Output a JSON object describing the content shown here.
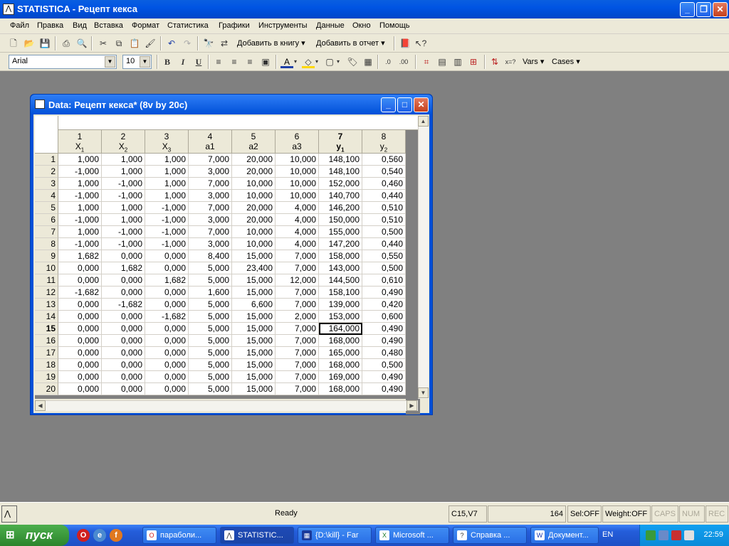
{
  "window": {
    "app_title": "STATISTICA - Рецепт кекса",
    "min_label": "_",
    "max_label": "❐",
    "close_label": "✕"
  },
  "menu": {
    "items": [
      "Файл",
      "Правка",
      "Вид",
      "Вставка",
      "Формат",
      "Статистика",
      "Графики",
      "Инструменты",
      "Данные",
      "Окно",
      "Помощь"
    ]
  },
  "toolbar": {
    "add_to_book": "Добавить в книгу",
    "add_to_report": "Добавить в отчет",
    "font_name": "Arial",
    "font_size": "10",
    "bold": "B",
    "italic": "I",
    "underline": "U",
    "vars": "Vars",
    "cases": "Cases"
  },
  "datawin": {
    "title": "Data: Рецепт кекса* (8v by 20c)",
    "columns": [
      {
        "num": "1",
        "name": "X",
        "sub": "1"
      },
      {
        "num": "2",
        "name": "X",
        "sub": "2"
      },
      {
        "num": "3",
        "name": "X",
        "sub": "3"
      },
      {
        "num": "4",
        "name": "a1",
        "sub": ""
      },
      {
        "num": "5",
        "name": "a2",
        "sub": ""
      },
      {
        "num": "6",
        "name": "a3",
        "sub": ""
      },
      {
        "num": "7",
        "name": "y",
        "sub": "1"
      },
      {
        "num": "8",
        "name": "y",
        "sub": "2"
      }
    ],
    "active_row": 15,
    "active_col": 7,
    "rows": [
      [
        "1,000",
        "1,000",
        "1,000",
        "7,000",
        "20,000",
        "10,000",
        "148,100",
        "0,560"
      ],
      [
        "-1,000",
        "1,000",
        "1,000",
        "3,000",
        "20,000",
        "10,000",
        "148,100",
        "0,540"
      ],
      [
        "1,000",
        "-1,000",
        "1,000",
        "7,000",
        "10,000",
        "10,000",
        "152,000",
        "0,460"
      ],
      [
        "-1,000",
        "-1,000",
        "1,000",
        "3,000",
        "10,000",
        "10,000",
        "140,700",
        "0,440"
      ],
      [
        "1,000",
        "1,000",
        "-1,000",
        "7,000",
        "20,000",
        "4,000",
        "146,200",
        "0,510"
      ],
      [
        "-1,000",
        "1,000",
        "-1,000",
        "3,000",
        "20,000",
        "4,000",
        "150,000",
        "0,510"
      ],
      [
        "1,000",
        "-1,000",
        "-1,000",
        "7,000",
        "10,000",
        "4,000",
        "155,000",
        "0,500"
      ],
      [
        "-1,000",
        "-1,000",
        "-1,000",
        "3,000",
        "10,000",
        "4,000",
        "147,200",
        "0,440"
      ],
      [
        "1,682",
        "0,000",
        "0,000",
        "8,400",
        "15,000",
        "7,000",
        "158,000",
        "0,550"
      ],
      [
        "0,000",
        "1,682",
        "0,000",
        "5,000",
        "23,400",
        "7,000",
        "143,000",
        "0,500"
      ],
      [
        "0,000",
        "0,000",
        "1,682",
        "5,000",
        "15,000",
        "12,000",
        "144,500",
        "0,610"
      ],
      [
        "-1,682",
        "0,000",
        "0,000",
        "1,600",
        "15,000",
        "7,000",
        "158,100",
        "0,490"
      ],
      [
        "0,000",
        "-1,682",
        "0,000",
        "5,000",
        "6,600",
        "7,000",
        "139,000",
        "0,420"
      ],
      [
        "0,000",
        "0,000",
        "-1,682",
        "5,000",
        "15,000",
        "2,000",
        "153,000",
        "0,600"
      ],
      [
        "0,000",
        "0,000",
        "0,000",
        "5,000",
        "15,000",
        "7,000",
        "164,000",
        "0,490"
      ],
      [
        "0,000",
        "0,000",
        "0,000",
        "5,000",
        "15,000",
        "7,000",
        "168,000",
        "0,490"
      ],
      [
        "0,000",
        "0,000",
        "0,000",
        "5,000",
        "15,000",
        "7,000",
        "165,000",
        "0,480"
      ],
      [
        "0,000",
        "0,000",
        "0,000",
        "5,000",
        "15,000",
        "7,000",
        "168,000",
        "0,500"
      ],
      [
        "0,000",
        "0,000",
        "0,000",
        "5,000",
        "15,000",
        "7,000",
        "169,000",
        "0,490"
      ],
      [
        "0,000",
        "0,000",
        "0,000",
        "5,000",
        "15,000",
        "7,000",
        "168,000",
        "0,490"
      ]
    ]
  },
  "status": {
    "ready": "Ready",
    "cell_ref": "C15,V7",
    "cell_value": "164",
    "sel": "Sel:OFF",
    "weight": "Weight:OFF",
    "caps": "CAPS",
    "num": "NUM",
    "rec": "REC"
  },
  "taskbar": {
    "start": "пуск",
    "tasks": [
      {
        "label": "параболи...",
        "icon": "O"
      },
      {
        "label": "STATISTIC...",
        "icon": "S"
      },
      {
        "label": "{D:\\kill} - Far",
        "icon": "F"
      },
      {
        "label": "Microsoft ...",
        "icon": "X"
      },
      {
        "label": "Справка ...",
        "icon": "?"
      },
      {
        "label": "Документ...",
        "icon": "W"
      }
    ],
    "lang": "EN",
    "clock": "22:59"
  }
}
